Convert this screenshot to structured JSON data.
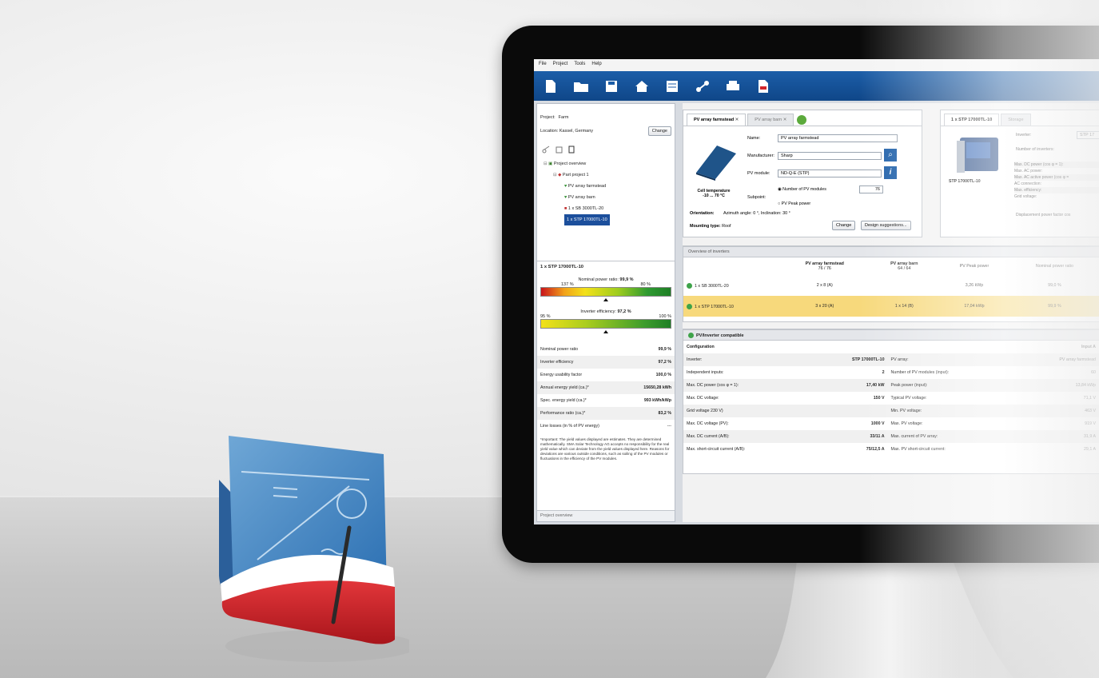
{
  "menu": [
    "File",
    "Project",
    "Tools",
    "Help"
  ],
  "toolbar_icons": [
    "new-file-icon",
    "open-folder-icon",
    "save-icon",
    "house-icon",
    "report-icon",
    "network-icon",
    "print-icon",
    "pdf-icon"
  ],
  "project": {
    "project_label": "Project:",
    "project_value": "Farm",
    "location_label": "Location:",
    "location_value": "Kassel, Germany",
    "change_btn": "Change"
  },
  "tree": {
    "root": "Project overview",
    "subproject": "Part project 1",
    "array1": "PV array farmstead",
    "array2": "PV array barn",
    "inverter1": "1 x SB 3000TL-20",
    "inverter2": "1 x STP 17000TL-10"
  },
  "inverter_panel": {
    "title": "1 x STP 17000TL-10",
    "power_ratio_label": "Nominal power ratio:",
    "power_ratio_value": "99,9 %",
    "scale_left": "137 %",
    "scale_right": "80 %",
    "efficiency_label": "Inverter efficiency:",
    "efficiency_value": "97,2 %",
    "eff_left": "95 %",
    "eff_right": "100 %"
  },
  "stats": [
    {
      "label": "Nominal power ratio",
      "value": "99,9 %"
    },
    {
      "label": "Inverter efficiency",
      "value": "97,2 %"
    },
    {
      "label": "Energy usability factor",
      "value": "100,0 %"
    },
    {
      "label": "Annual energy yield (ca.)*",
      "value": "15650,28 kWh"
    },
    {
      "label": "Spec. energy yield (ca.)*",
      "value": "993 kWh/kWp"
    },
    {
      "label": "Performance ratio (ca.)*",
      "value": "83,2 %"
    },
    {
      "label": "Line losses (in % of PV energy)",
      "value": "---"
    }
  ],
  "disclaimer": "*Important: The yield values displayed are estimates. They are determined mathematically. SMA Solar Technology AG accepts no responsibility for the real yield value which can deviate from the yield values displayed here. Reasons for deviations are various outside conditions, such as soiling of the PV modules or fluctuations in the efficiency of the PV modules.",
  "left_footer": "Project overview",
  "tabs": {
    "tab1": "PV array farmstead",
    "tab2": "PV array barn",
    "inv_tab1": "1 x STP 17000TL-10",
    "inv_tab2": "Storage"
  },
  "array_form": {
    "name_label": "Name:",
    "name_value": "PV array farmstead",
    "manufacturer_label": "Manufacturer:",
    "manufacturer_value": "Sharp",
    "pv_module_label": "PV module:",
    "pv_module_value": "ND-Q-E (STP)",
    "subpoint_label": "Subpoint:",
    "opt1": "Number of PV modules",
    "opt2": "PV Peak power",
    "count_value": "76",
    "cell_temp_label": "Cell temperature",
    "cell_temp_value": "-10 ... 70 °C",
    "orientation_label": "Orientation:",
    "orientation_value": "Azimuth angle: 0 °, Inclination: 30 °",
    "mounting_label": "Mounting type:",
    "mounting_value": "Roof",
    "change_btn": "Change",
    "design_btn": "Design suggestions..."
  },
  "inverter_form": {
    "inverter_label": "Inverter:",
    "inverter_value": "STP 17",
    "num_label": "Number of inverters:",
    "caption": "STP 17000TL-10",
    "rows": [
      "Max. DC power (cos φ = 1):",
      "Max. AC power:",
      "Max. AC active power (cos φ =",
      "AC connection:",
      "Max. efficiency:",
      "Grid voltage:"
    ],
    "displacement": "Displacement power factor cos"
  },
  "overview": {
    "section_title": "Overview of inverters",
    "headers": [
      "",
      "PV array farmstead",
      "PV array barn",
      "PV Peak power",
      "Nominal power ratio"
    ],
    "sub": [
      "",
      "76 / 76",
      "64 / 64",
      "",
      ""
    ],
    "rows": [
      {
        "name": "1 x SB 3000TL-20",
        "a": "2 x 8 (A)",
        "b": "",
        "p": "3,26 kWp",
        "r": "99,0 %"
      },
      {
        "name": "1 x STP 17000TL-10",
        "a": "3 x 20 (A)",
        "b": "1 x 14 (B)",
        "p": "17,04 kWp",
        "r": "99,9 %"
      }
    ]
  },
  "compat": {
    "title": "PV/Inverter compatible",
    "config": "Configuration",
    "input": "Input A",
    "rows": [
      [
        "Inverter:",
        "STP 17000TL-10",
        "PV array:",
        "PV array farmstead"
      ],
      [
        "Independent inputs:",
        "2",
        "Number of PV modules (input):",
        "60"
      ],
      [
        "Max. DC power (cos φ = 1):",
        "17,40 kW",
        "Peak power (input):",
        "13,84 kWp"
      ],
      [
        "Max. DC voltage:",
        "150 V",
        "Typical PV voltage:",
        "71,1 V"
      ],
      [
        "Grid voltage 230 V)",
        "",
        "Min. PV voltage:",
        "463 V"
      ],
      [
        "Max. DC voltage (PV):",
        "1000 V",
        "Max. PV voltage:",
        "919 V"
      ],
      [
        "Max. DC current (A/B):",
        "33/11 A",
        "Max. current of PV array:",
        "31,9 A"
      ],
      [
        "Max. short-circuit current (A/B):",
        "75/12,5 A",
        "Max. PV short-circuit current:",
        "29,1 A"
      ]
    ]
  },
  "colors": {
    "toolbar": "#1c5ea8",
    "highlight": "#f7d97c",
    "accent_red": "#d2262b"
  }
}
